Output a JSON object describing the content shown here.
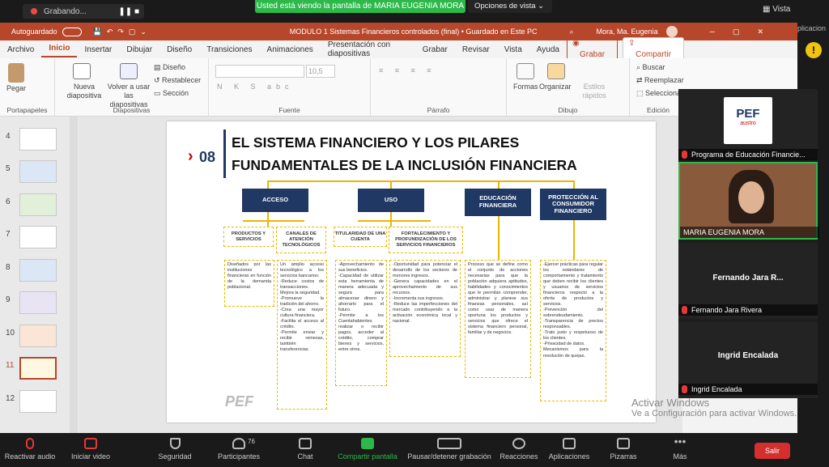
{
  "zoom_top": {
    "recording": "Grabando...",
    "share_banner": "Usted está viendo la pantalla de MARIA EUGENIA MORA",
    "options": "Opciones de vista",
    "view": "Vista",
    "apps_cut": "plicacion"
  },
  "ppt": {
    "autosave": "Autoguardado",
    "title": "MODULO 1 Sistemas Financieros controlados (final) • Guardado en Este PC",
    "user": "Mora, Ma. Eugenia",
    "tabs": [
      "Archivo",
      "Inicio",
      "Insertar",
      "Dibujar",
      "Diseño",
      "Transiciones",
      "Animaciones",
      "Presentación con diapositivas",
      "Grabar",
      "Revisar",
      "Vista",
      "Ayuda"
    ],
    "record_btn": "Grabar",
    "share_btn": "Compartir",
    "ribbon": {
      "paste": "Pegar",
      "clipboard": "Portapapeles",
      "new_slide": "Nueva diapositiva",
      "reuse": "Volver a usar las diapositivas",
      "design": "Diseño",
      "reset": "Restablecer",
      "section": "Sección",
      "slides_group": "Diapositivas",
      "font_size": "10,5",
      "font_group": "Fuente",
      "para_group": "Párrafo",
      "shapes": "Formas",
      "arrange": "Organizar",
      "quick_styles": "Estilos rápidos",
      "draw_group": "Dibujo",
      "find": "Buscar",
      "replace": "Reemplazar",
      "select": "Seleccionar",
      "edit_group": "Edición"
    },
    "thumb_numbers": [
      "4",
      "5",
      "6",
      "7",
      "8",
      "9",
      "10",
      "11",
      "12"
    ]
  },
  "slide": {
    "num": "08",
    "title_line1": "EL SISTEMA FINANCIERO Y LOS PILARES",
    "title_line2": "FUNDAMENTALES DE LA INCLUSIÓN FINANCIERA",
    "heads": {
      "acceso": "ACCESO",
      "uso": "USO",
      "educacion": "EDUCACIÓN FINANCIERA",
      "proteccion": "PROTECCIÓN AL CONSUMIDOR FINANCIERO"
    },
    "subs": {
      "productos": "PRODUCTOS Y SERVICIOS",
      "canales": "CANALES DE ATENCIÓN TECNOLÓGICOS",
      "titularidad": "TITULARIDAD DE UNA CUENTA",
      "fortalecimiento": "FORTALECIMIENTO Y PROFUNDIZACIÓN DE LOS SERVICIOS FINANCIEROS"
    },
    "texts": {
      "productos": "Diseñados por las instituciones financieras en función de la demanda poblacional.",
      "canales": "Un amplio acceso tecnológico a los servicios bancarios:\n-Reduce costos de transacciones. -Mejora la seguridad.\n-Promueve la tradición del ahorro.\n-Crea una mayor cultura financiera.\n-Facilita el acceso al crédito.\n-Permite enviar y recibir remesas, también transferencias.",
      "titularidad": "-Aprovechamiento de sus beneficios.\n-Capacidad de utilizar esta herramienta de manera adecuada y segura para almacenar dinero y ahorrarlo para el futuro.\n-Permite a los Cuentahabientes realizar o recibir pagos, acceder al crédito, comprar bienes y servicios, entre otros.",
      "fortalecimiento": "-Oportunidad para potenciar el desarrollo de los sectores de menores ingresos.\n-Genera capacidades en el aprovechamiento de sus recursos.\n-Incrementa sus ingresos.\n-Reduce las imperfecciones del mercado contribuyendo a la activación económica local y nacional.",
      "educacion": "Proceso que se define como el conjunto de acciones necesarias para que la población adquiera aptitudes, habilidades y conocimientos que le permitan comprender, administrar y planear sus finanzas personales, así como usar de manera oportuna los productos y servicios que ofrece el sistema financiero personal, familiar y de negocios.",
      "proteccion": "-Ejercer prácticas para regular los estándares de comportamiento y tratamiento que deben recibir los clientes y usuarios de servicios financieros respecto a la oferta de productos y servicios.\n-Prevención del sobrendeudamiento.\n-Transparencia de precios responsables.\n-Trato justo y respetuoso de los clientes.\n-Privacidad de datos.\nMecanismos para la resolución de quejas."
    },
    "logo": "PEF"
  },
  "participants": {
    "logo": "PEF",
    "logo_sub": "austro",
    "p1": "Programa de Educación Financie...",
    "p2": "MARIA EUGENIA MORA",
    "p3_big": "Fernando Jara R...",
    "p3": "Fernando Jara Rivera",
    "p4_big": "Ingrid Encalada",
    "p4": "Ingrid Encalada"
  },
  "activate": {
    "line1": "Activar Windows",
    "line2": "Ve a Configuración para activar Windows."
  },
  "zoom_bottom": {
    "audio": "Reactivar audio",
    "video": "Iniciar video",
    "security": "Seguridad",
    "participants": "Participantes",
    "participants_count": "76",
    "chat": "Chat",
    "share": "Compartir pantalla",
    "record": "Pausar/detener grabación",
    "reactions": "Reacciones",
    "apps": "Aplicaciones",
    "whiteboard": "Pizarras",
    "more": "Más",
    "leave": "Salir"
  }
}
